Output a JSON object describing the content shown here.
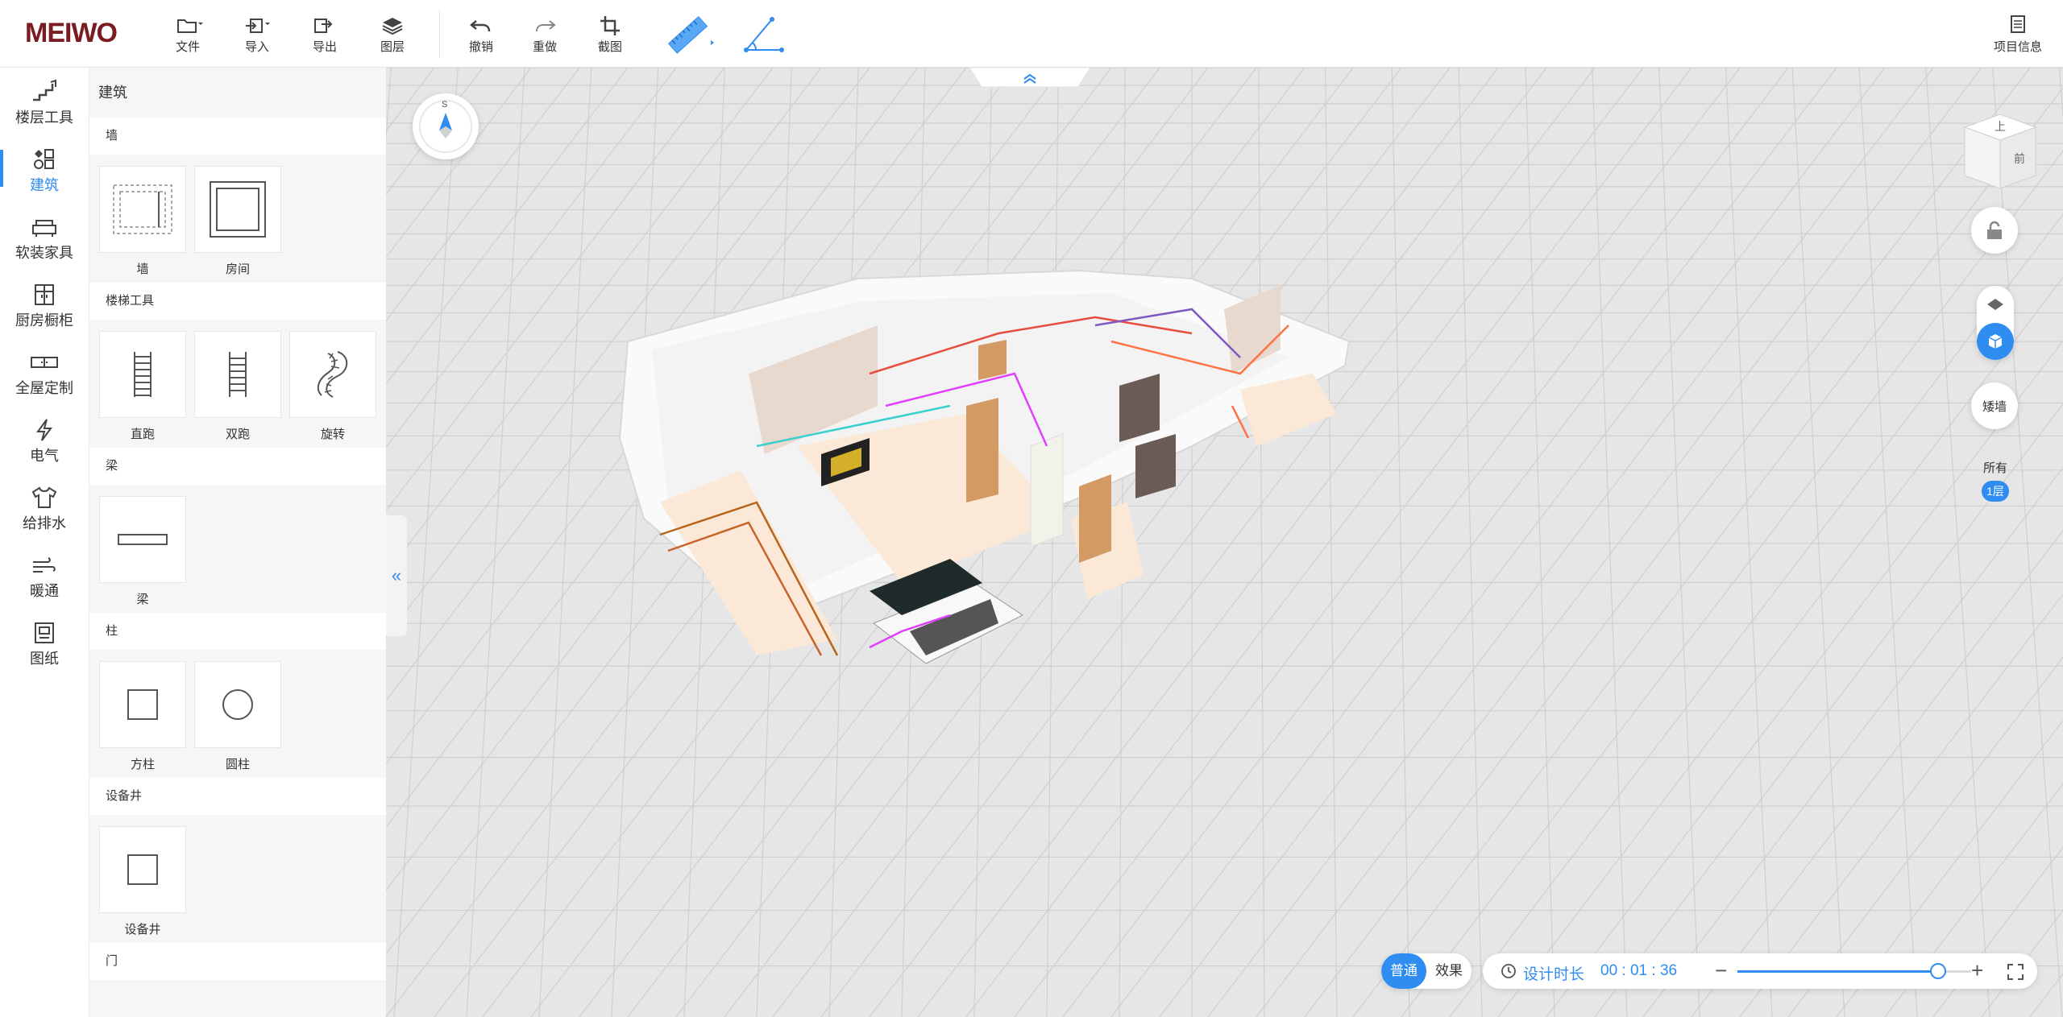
{
  "app": {
    "logo": "MEIWO"
  },
  "toolbar": {
    "file": "文件",
    "import": "导入",
    "export": "导出",
    "layers": "图层",
    "undo": "撤销",
    "redo": "重做",
    "screenshot": "截图",
    "project_info": "项目信息"
  },
  "sidebar": {
    "items": [
      {
        "label": "楼层工具",
        "icon": "floor-stairs-icon"
      },
      {
        "label": "建筑",
        "icon": "building-blocks-icon",
        "active": true
      },
      {
        "label": "软装家具",
        "icon": "sofa-icon"
      },
      {
        "label": "厨房橱柜",
        "icon": "cabinet-icon"
      },
      {
        "label": "全屋定制",
        "icon": "wardrobe-icon"
      },
      {
        "label": "电气",
        "icon": "lightning-icon"
      },
      {
        "label": "给排水",
        "icon": "shirt-icon"
      },
      {
        "label": "暖通",
        "icon": "wind-icon"
      },
      {
        "label": "图纸",
        "icon": "drawing-icon"
      }
    ]
  },
  "panel": {
    "title": "建筑",
    "sections": {
      "wall": {
        "title": "墙",
        "items": [
          "墙",
          "房间"
        ]
      },
      "stairs": {
        "title": "楼梯工具",
        "items": [
          "直跑",
          "双跑",
          "旋转"
        ]
      },
      "beam": {
        "title": "梁",
        "items": [
          "梁"
        ]
      },
      "column": {
        "title": "柱",
        "items": [
          "方柱",
          "圆柱"
        ]
      },
      "shaft": {
        "title": "设备井",
        "items": [
          "设备井"
        ]
      },
      "door": {
        "title": "门"
      }
    }
  },
  "viewport": {
    "compass_label": "S",
    "cube_top": "上",
    "cube_front": "前",
    "short_wall": "矮墙",
    "floor_all": "所有",
    "floor_current": "1层"
  },
  "bottom": {
    "mode_normal": "普通",
    "mode_effect": "效果",
    "design_time_label": "设计时长",
    "design_time_value": "00 : 01 : 36",
    "zoom_fraction": 0.86
  },
  "colors": {
    "accent": "#2f8cf0",
    "logo": "#7b1c22",
    "grid": "#cfcfcf",
    "floor": "#fbe8d6"
  }
}
